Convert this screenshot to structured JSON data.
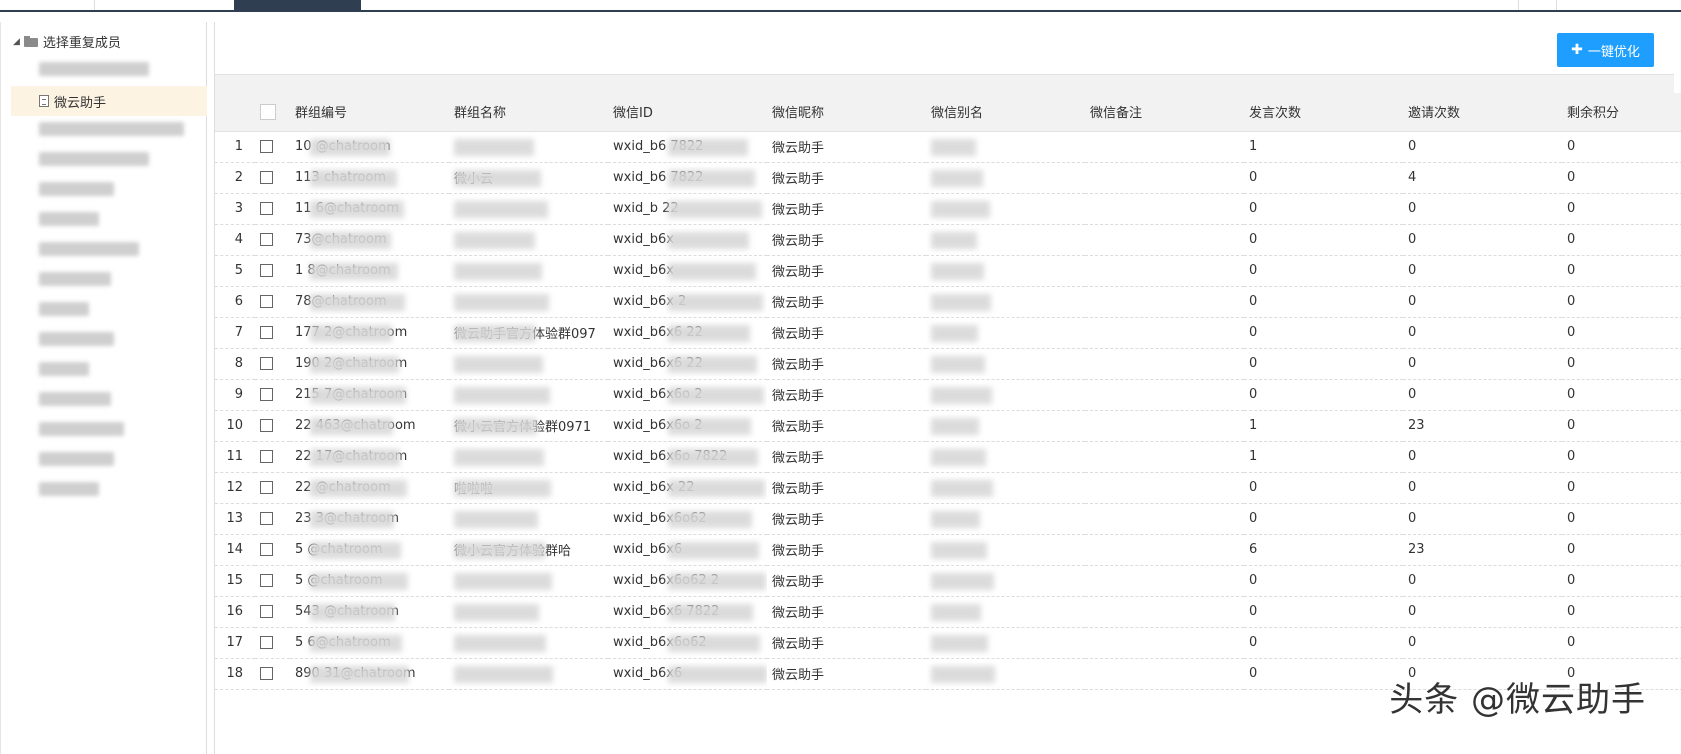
{
  "tree": {
    "root_label": "选择重复成员",
    "selected_item_label": "微云助手"
  },
  "toolbar": {
    "optimize_button_label": "一键优化"
  },
  "table": {
    "columns": [
      "",
      "",
      "群组编号",
      "群组名称",
      "微信ID",
      "微信昵称",
      "微信别名",
      "微信备注",
      "发言次数",
      "邀请次数",
      "剩余积分"
    ],
    "rows": [
      {
        "n": "1",
        "gid": "10        @chatroom",
        "gname": "",
        "wxid": "wxid_b6       7822",
        "nick": "微云助手",
        "alias": "",
        "remark": "",
        "speak": "1",
        "invite": "0",
        "points": "0"
      },
      {
        "n": "2",
        "gid": "113       chatroom",
        "gname": "微小云",
        "wxid": "wxid_b6       7822",
        "nick": "微云助手",
        "alias": "",
        "remark": "",
        "speak": "0",
        "invite": "4",
        "points": "0"
      },
      {
        "n": "3",
        "gid": "11        6@chatroom",
        "gname": "",
        "wxid": "wxid_b        22",
        "nick": "微云助手",
        "alias": "",
        "remark": "",
        "speak": "0",
        "invite": "0",
        "points": "0"
      },
      {
        "n": "4",
        "gid": "         73@chatroom",
        "gname": "",
        "wxid": "wxid_b6x",
        "nick": "微云助手",
        "alias": "",
        "remark": "",
        "speak": "0",
        "invite": "0",
        "points": "0"
      },
      {
        "n": "5",
        "gid": "1        8@chatroom",
        "gname": "",
        "wxid": "wxid_b6x",
        "nick": "微云助手",
        "alias": "",
        "remark": "",
        "speak": "0",
        "invite": "0",
        "points": "0"
      },
      {
        "n": "6",
        "gid": "         78@chatroom",
        "gname": "",
        "wxid": "wxid_b6x        2",
        "nick": "微云助手",
        "alias": "",
        "remark": "",
        "speak": "0",
        "invite": "0",
        "points": "0"
      },
      {
        "n": "7",
        "gid": "177      2@chatroom",
        "gname": "微云助手官方体验群097",
        "wxid": "wxid_b6x6       22",
        "nick": "微云助手",
        "alias": "",
        "remark": "",
        "speak": "0",
        "invite": "0",
        "points": "0"
      },
      {
        "n": "8",
        "gid": "190      2@chatroom",
        "gname": "",
        "wxid": "wxid_b6x6       22",
        "nick": "微云助手",
        "alias": "",
        "remark": "",
        "speak": "0",
        "invite": "0",
        "points": "0"
      },
      {
        "n": "9",
        "gid": "215      7@chatroom",
        "gname": "",
        "wxid": "wxid_b6x6o      2",
        "nick": "微云助手",
        "alias": "",
        "remark": "",
        "speak": "0",
        "invite": "0",
        "points": "0"
      },
      {
        "n": "10",
        "gid": "22       463@chatroom",
        "gname": "微小云官方体验群0971",
        "wxid": "wxid_b6x6o      2",
        "nick": "微云助手",
        "alias": "",
        "remark": "",
        "speak": "1",
        "invite": "23",
        "points": "0"
      },
      {
        "n": "11",
        "gid": "22       17@chatroom",
        "gname": "",
        "wxid": "wxid_b6x6o     7822",
        "nick": "微云助手",
        "alias": "",
        "remark": "",
        "speak": "1",
        "invite": "0",
        "points": "0"
      },
      {
        "n": "12",
        "gid": "22       @chatroom",
        "gname": "啦啦啦",
        "wxid": "wxid_b6x       22",
        "nick": "微云助手",
        "alias": "",
        "remark": "",
        "speak": "0",
        "invite": "0",
        "points": "0"
      },
      {
        "n": "13",
        "gid": "23       3@chatroom",
        "gname": "",
        "wxid": "wxid_b6x6o62",
        "nick": "微云助手",
        "alias": "",
        "remark": "",
        "speak": "0",
        "invite": "0",
        "points": "0"
      },
      {
        "n": "14",
        "gid": "5        @chatroom",
        "gname": "微小云官方体验群哈",
        "wxid": "wxid_b6x6",
        "nick": "微云助手",
        "alias": "",
        "remark": "",
        "speak": "6",
        "invite": "23",
        "points": "0"
      },
      {
        "n": "15",
        "gid": "5        @chatroom",
        "gname": "",
        "wxid": "wxid_b6x6o62      2",
        "nick": "微云助手",
        "alias": "",
        "remark": "",
        "speak": "0",
        "invite": "0",
        "points": "0"
      },
      {
        "n": "16",
        "gid": "543      @chatroom",
        "gname": "",
        "wxid": "wxid_b6x6      7822",
        "nick": "微云助手",
        "alias": "",
        "remark": "",
        "speak": "0",
        "invite": "0",
        "points": "0"
      },
      {
        "n": "17",
        "gid": "5        6@chatroom",
        "gname": "",
        "wxid": "wxid_b6x6o62",
        "nick": "微云助手",
        "alias": "",
        "remark": "",
        "speak": "0",
        "invite": "0",
        "points": "0"
      },
      {
        "n": "18",
        "gid": "890      31@chatroom",
        "gname": "",
        "wxid": "wxid_b6x6",
        "nick": "微云助手",
        "alias": "",
        "remark": "",
        "speak": "0",
        "invite": "0",
        "points": "0"
      }
    ]
  },
  "watermark": "头条 @微云助手",
  "colors": {
    "accent": "#1e9fff",
    "header_bg": "#f2f2f2",
    "selected_bg": "#fdf3e3",
    "topbar_active": "#2f3e50"
  }
}
